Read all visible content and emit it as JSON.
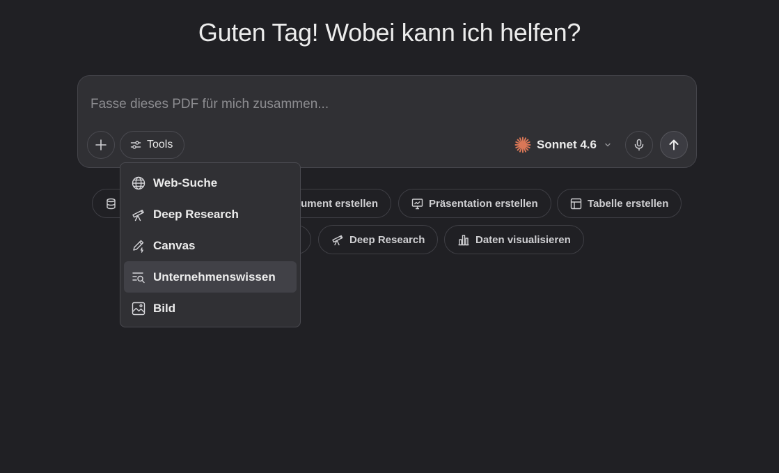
{
  "greeting": "Guten Tag! Wobei kann ich helfen?",
  "composer": {
    "placeholder": "Fasse dieses PDF für mich zusammen...",
    "tools_label": "Tools",
    "model_label": "Sonnet 4.6",
    "icons": {
      "plus": "plus-icon",
      "tools": "sliders-icon",
      "model": "sparkle-logo-icon",
      "chevron": "chevron-down-icon",
      "mic": "microphone-icon",
      "send": "arrow-up-icon"
    },
    "accent_color": "#d97757"
  },
  "suggestions": {
    "row1": [
      {
        "label": "",
        "icon": "database-icon"
      },
      {
        "label": "ument erstellen",
        "icon": "document-icon"
      },
      {
        "label": "Präsentation erstellen",
        "icon": "presentation-icon"
      },
      {
        "label": "Tabelle erstellen",
        "icon": "table-icon"
      }
    ],
    "row2": [
      {
        "label": "",
        "icon": ""
      },
      {
        "label": "Deep Research",
        "icon": "telescope-icon"
      },
      {
        "label": "Daten visualisieren",
        "icon": "bar-chart-icon"
      }
    ]
  },
  "tools_menu": {
    "items": [
      {
        "label": "Web-Suche",
        "icon": "globe-icon"
      },
      {
        "label": "Deep Research",
        "icon": "telescope-icon"
      },
      {
        "label": "Canvas",
        "icon": "pencil-icon"
      },
      {
        "label": "Unternehmenswissen",
        "icon": "list-search-icon",
        "highlighted": true
      },
      {
        "label": "Bild",
        "icon": "image-icon"
      }
    ]
  }
}
